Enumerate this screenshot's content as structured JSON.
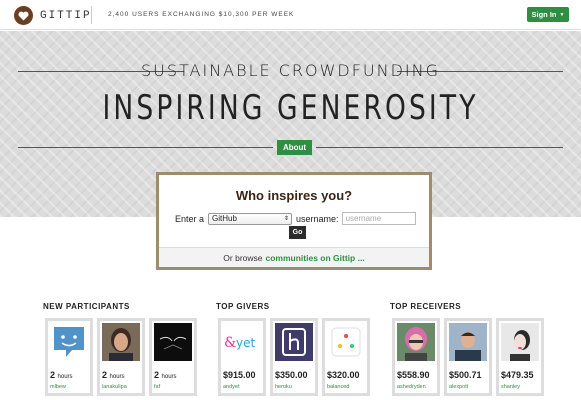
{
  "header": {
    "logo_text": "GITTIP",
    "tagline": "2,400 USERS EXCHANGING $10,300 PER WEEK",
    "signin_label": "Sign In"
  },
  "hero": {
    "subtitle": "SUSTAINABLE CROWDFUNDING",
    "title": "INSPIRING GENEROSITY",
    "about_label": "About"
  },
  "inspire": {
    "title": "Who inspires you?",
    "enter_label": "Enter a",
    "platform_selected": "GitHub",
    "username_label": "username:",
    "username_placeholder": "username",
    "go_label": "Go",
    "browse_prefix": "Or browse",
    "browse_link": "communities on Gittip ..."
  },
  "sections": {
    "new_participants": {
      "title": "NEW PARTICIPANTS",
      "items": [
        {
          "amount": "2",
          "unit": "hours",
          "user": "mlbew"
        },
        {
          "amount": "2",
          "unit": "hours",
          "user": "lanakulipa"
        },
        {
          "amount": "2",
          "unit": "hours",
          "user": "faf"
        }
      ]
    },
    "top_givers": {
      "title": "TOP GIVERS",
      "items": [
        {
          "amount": "$915.00",
          "user": "andyet"
        },
        {
          "amount": "$350.00",
          "user": "heroku"
        },
        {
          "amount": "$320.00",
          "user": "balanced"
        }
      ]
    },
    "top_receivers": {
      "title": "TOP RECEIVERS",
      "items": [
        {
          "amount": "$558.90",
          "user": "ashedryden"
        },
        {
          "amount": "$500.71",
          "user": "alexpott"
        },
        {
          "amount": "$479.35",
          "user": "shanley"
        }
      ]
    }
  },
  "colors": {
    "brand_green": "#2e8f43",
    "logo_brown": "#6b3e24",
    "box_border": "#a08a72"
  }
}
